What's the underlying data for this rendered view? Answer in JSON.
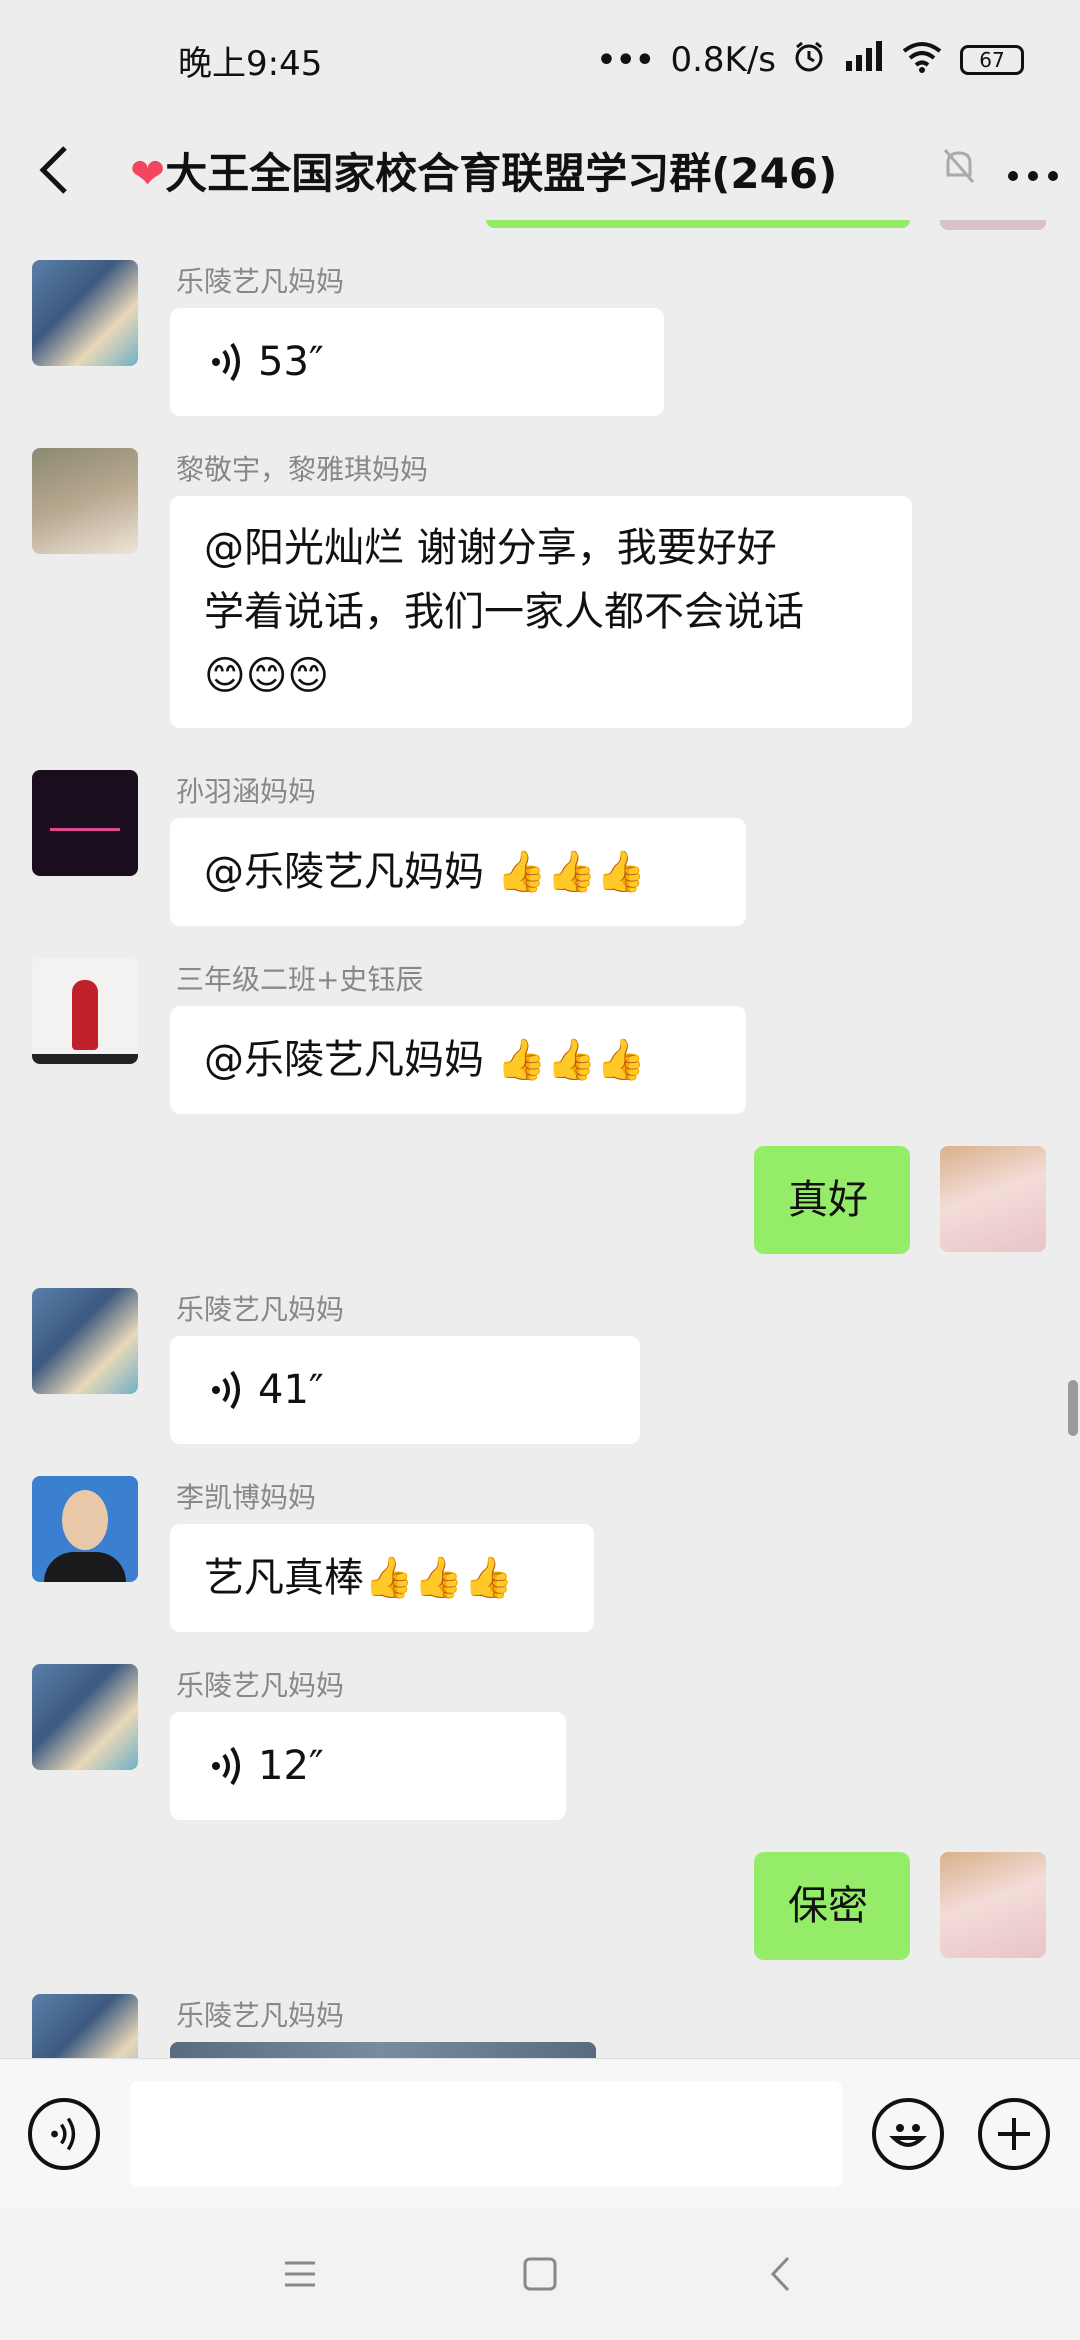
{
  "status": {
    "time": "晚上9:45",
    "net_speed": "0.8K/s",
    "battery": "67"
  },
  "header": {
    "title": "大王全国家校合育联盟学习群(246)"
  },
  "input": {
    "placeholder": ""
  },
  "messages": [
    {
      "sender": "乐陵艺凡妈妈",
      "type": "voice",
      "duration": "53″"
    },
    {
      "sender": "黎敬宇，黎雅琪妈妈",
      "type": "text",
      "lines": [
        "@阳光灿烂  谢谢分享，我要好好",
        "学着说话，我们一家人都不会说话",
        "😊😊😊"
      ]
    },
    {
      "sender": "孙羽涵妈妈",
      "type": "text",
      "text": "@乐陵艺凡妈妈 ",
      "emoji": "👍👍👍"
    },
    {
      "sender": "三年级二班+史钰辰",
      "type": "text",
      "text": "@乐陵艺凡妈妈 ",
      "emoji": "👍👍👍"
    },
    {
      "sender": "me",
      "type": "text",
      "text": "真好"
    },
    {
      "sender": "乐陵艺凡妈妈",
      "type": "voice",
      "duration": "41″"
    },
    {
      "sender": "李凯博妈妈",
      "type": "text",
      "text": "艺凡真棒",
      "emoji": "👍👍👍"
    },
    {
      "sender": "乐陵艺凡妈妈",
      "type": "voice",
      "duration": "12″"
    },
    {
      "sender": "me",
      "type": "text",
      "text": "保密"
    },
    {
      "sender": "乐陵艺凡妈妈",
      "type": "image"
    }
  ],
  "colors": {
    "chat_bg": "#ededed",
    "self_bubble": "#95ec69",
    "other_bubble": "#ffffff"
  }
}
